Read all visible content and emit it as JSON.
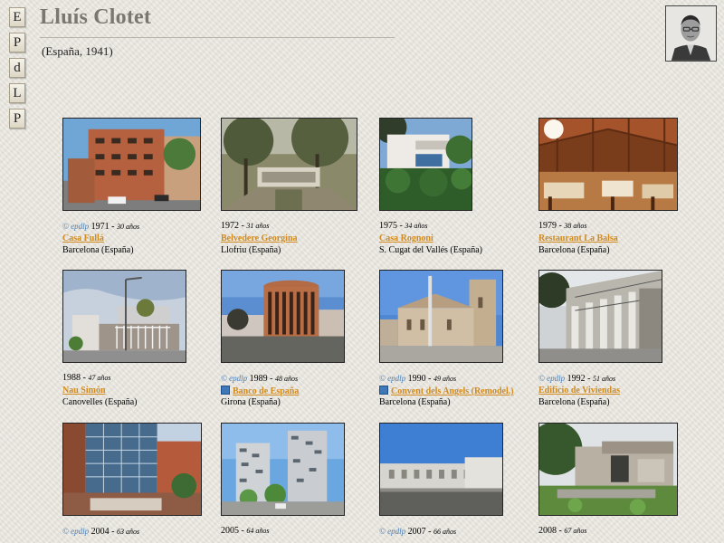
{
  "sidebar": [
    {
      "letter": "E"
    },
    {
      "letter": "P"
    },
    {
      "letter": "d"
    },
    {
      "letter": "L"
    },
    {
      "letter": "P"
    }
  ],
  "header": {
    "title": "Lluís Clotet",
    "subtitle": "(España, 1941)"
  },
  "copyright_label": "© epdlp",
  "works": [
    {
      "year": "1971",
      "age": "30 años",
      "name": "Casa Fullá",
      "place": "Barcelona (España)",
      "copy": true,
      "bullet": false
    },
    {
      "year": "1972",
      "age": "31 años",
      "name": "Belvedere Georgina",
      "place": "Llofriu (España)",
      "copy": false,
      "bullet": false
    },
    {
      "year": "1975",
      "age": "34 años",
      "name": "Casa Rognoni",
      "place": "S. Cugat del Vallés (España)",
      "copy": false,
      "bullet": false
    },
    {
      "year": "1979",
      "age": "38 años",
      "name": "Restaurant La Balsa",
      "place": "Barcelona (España)",
      "copy": false,
      "bullet": false
    },
    {
      "year": "1988",
      "age": "47 años",
      "name": "Nau Simón",
      "place": "Canovelles (España)",
      "copy": false,
      "bullet": false
    },
    {
      "year": "1989",
      "age": "48 años",
      "name": "Banco de España",
      "place": "Girona (España)",
      "copy": true,
      "bullet": true
    },
    {
      "year": "1990",
      "age": "49 años",
      "name": "Convent dels Angels (Remodel.)",
      "place": "Barcelona (España)",
      "copy": true,
      "bullet": true
    },
    {
      "year": "1992",
      "age": "51 años",
      "name": "Edificio de Viviendas",
      "place": "Barcelona (España)",
      "copy": true,
      "bullet": false
    },
    {
      "year": "2004",
      "age": "63 años",
      "name": "",
      "place": "",
      "copy": true,
      "bullet": false
    },
    {
      "year": "2005",
      "age": "64 años",
      "name": "",
      "place": "",
      "copy": false,
      "bullet": false
    },
    {
      "year": "2007",
      "age": "66 años",
      "name": "",
      "place": "",
      "copy": true,
      "bullet": false
    },
    {
      "year": "2008",
      "age": "67 años",
      "name": "",
      "place": "",
      "copy": false,
      "bullet": false
    }
  ],
  "colors": {
    "link": "#d08a1f",
    "copyright": "#4a7fb5",
    "title": "#7a7670"
  }
}
